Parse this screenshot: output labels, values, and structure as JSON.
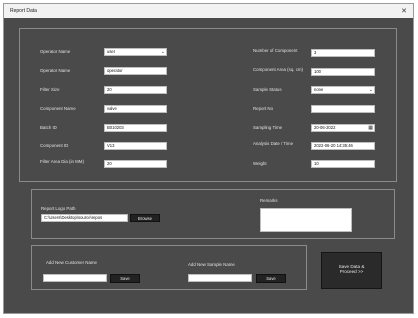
{
  "window": {
    "title": "Report Data",
    "close_glyph": "✕"
  },
  "left_fields": [
    {
      "label": "Operator Name",
      "value": "user",
      "type": "select"
    },
    {
      "label": "Operator Name",
      "value": "operator",
      "type": "input"
    },
    {
      "label": "Filter Size",
      "value": "20",
      "type": "input"
    },
    {
      "label": "Component Name",
      "value": "valve",
      "type": "input"
    },
    {
      "label": "Batch ID",
      "value": "B010203",
      "type": "input"
    },
    {
      "label": "Component ID",
      "value": "V13",
      "type": "input"
    },
    {
      "label": "Filter Area Dia (in MM)",
      "value": "20",
      "type": "input"
    }
  ],
  "right_fields": [
    {
      "label": "Number of Component",
      "value": "3",
      "type": "input"
    },
    {
      "label": "Component Area (sq. cm)",
      "value": "100",
      "type": "input"
    },
    {
      "label": "Sample Status",
      "value": "none",
      "type": "select"
    },
    {
      "label": "Report No",
      "value": "",
      "type": "input"
    },
    {
      "label": "Sampling Time",
      "value": "20-06-2022",
      "type": "date"
    },
    {
      "label": "Analysis Date / Time",
      "value": "2022-06-20 14:35:46",
      "type": "input"
    },
    {
      "label": "Weight",
      "value": "10",
      "type": "input"
    }
  ],
  "logo": {
    "label": "Report Logo Path",
    "path": "C:\\Users\\Desktop\\source\\repos",
    "browse_label": "Browse"
  },
  "remarks": {
    "label": "Remarks",
    "value": ""
  },
  "customer": {
    "label": "Add New Customer Name",
    "value": "",
    "button": "Save"
  },
  "sample": {
    "label": "Add New Sample Name",
    "value": "",
    "button": "Save"
  },
  "save_button": {
    "line1": "Save Data &",
    "line2": "Proceed >>"
  },
  "colors": {
    "background": "#4a4a4a",
    "field": "#ffffff",
    "button": "#222222"
  }
}
